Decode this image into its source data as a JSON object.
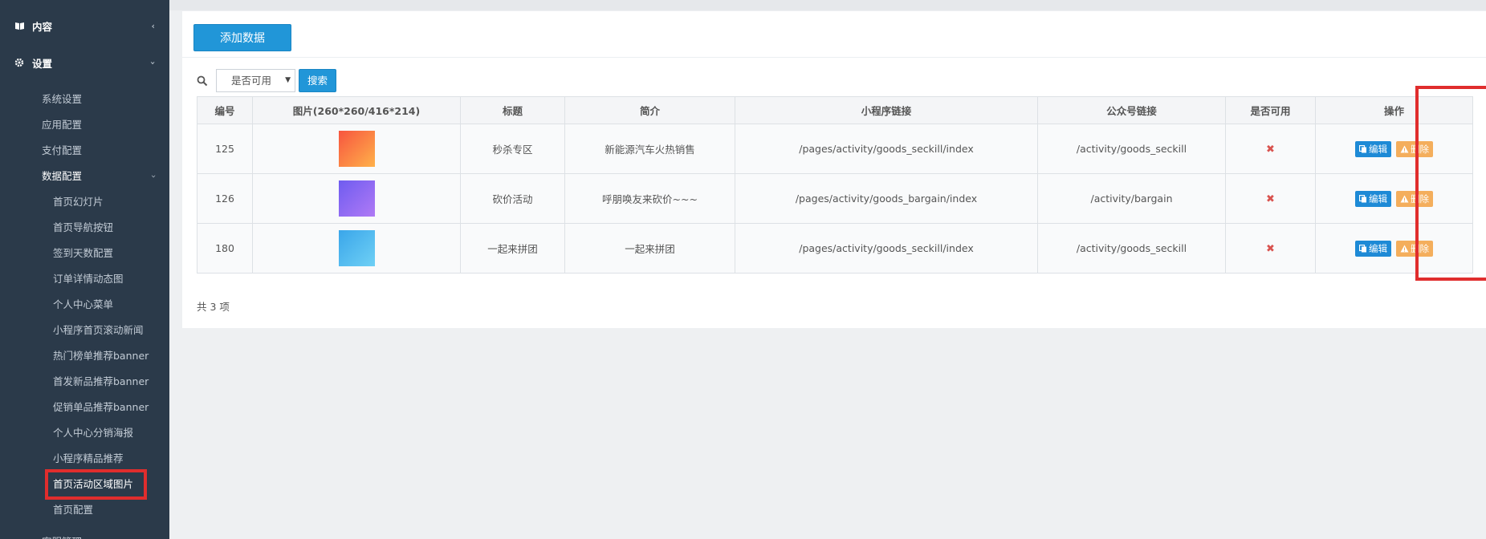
{
  "sidebar": {
    "groups": [
      {
        "label": "内容",
        "arrow": "‹",
        "icon": "book-icon"
      },
      {
        "label": "设置",
        "arrow": "›",
        "icon": "gear-icon"
      }
    ],
    "settings_items": [
      "系统设置",
      "应用配置",
      "支付配置"
    ],
    "data_config": {
      "label": "数据配置",
      "arrow": "›"
    },
    "data_config_items": [
      "首页幻灯片",
      "首页导航按钮",
      "签到天数配置",
      "订单详情动态图",
      "个人中心菜单",
      "小程序首页滚动新闻",
      "热门榜单推荐banner",
      "首发新品推荐banner",
      "促销单品推荐banner",
      "个人中心分销海报",
      "小程序精品推荐",
      "首页活动区域图片",
      "首页配置"
    ],
    "cut_item": "客服管理"
  },
  "toolbar": {
    "add_label": "添加数据"
  },
  "search": {
    "select_value": "是否可用",
    "search_label": "搜索"
  },
  "table": {
    "headers": [
      "编号",
      "图片(260*260/416*214)",
      "标题",
      "简介",
      "小程序链接",
      "公众号链接",
      "是否可用",
      "操作"
    ],
    "rows": [
      {
        "id": "125",
        "title": "秒杀专区",
        "intro": "新能源汽车火热销售",
        "mini_link": "/pages/activity/goods_seckill/index",
        "mp_link": "/activity/goods_seckill",
        "available": "✖",
        "thumb_colors": [
          "#f7553f",
          "#ffb14a"
        ]
      },
      {
        "id": "126",
        "title": "砍价活动",
        "intro": "呼朋唤友来砍价~~~",
        "mini_link": "/pages/activity/goods_bargain/index",
        "mp_link": "/activity/bargain",
        "available": "✖",
        "thumb_colors": [
          "#6f5cf0",
          "#b07af5"
        ]
      },
      {
        "id": "180",
        "title": "一起来拼团",
        "intro": "一起来拼团",
        "mini_link": "/pages/activity/goods_seckill/index",
        "mp_link": "/activity/goods_seckill",
        "available": "✖",
        "thumb_colors": [
          "#3aa6ea",
          "#6fd0f5"
        ]
      }
    ],
    "edit_label": "编辑",
    "delete_label": "删除"
  },
  "footer": {
    "total": "共 3 项"
  },
  "colors": {
    "sidebar_bg": "#2b3a4a",
    "primary": "#2196d8",
    "warning": "#f4ae5c",
    "highlight": "#e02d2d",
    "danger": "#d9534f"
  }
}
